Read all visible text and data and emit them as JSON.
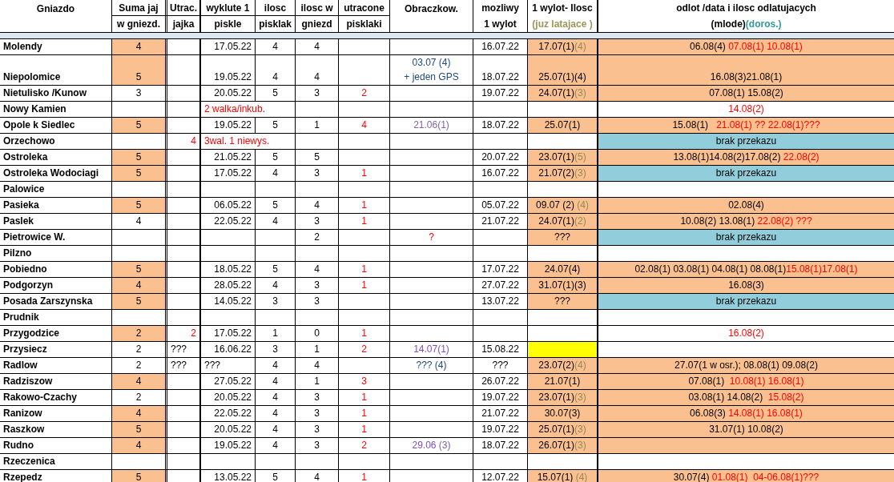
{
  "header": {
    "name": {
      "lines": [
        {
          "text": "Gniazdo"
        }
      ]
    },
    "suma": {
      "lines": [
        {
          "text": "Suma jaj"
        },
        {
          "text": "w gniezd."
        }
      ]
    },
    "utrac": {
      "lines": [
        {
          "text": "Utrac."
        },
        {
          "text": "jajka"
        }
      ]
    },
    "wyklute": {
      "lines": [
        {
          "text": "wyklute 1"
        },
        {
          "text": "piskle"
        }
      ]
    },
    "ilosc": {
      "lines": [
        {
          "text": "ilosc"
        },
        {
          "text": "pisklak"
        }
      ]
    },
    "ilosc_w": {
      "lines": [
        {
          "text": "ilosc w"
        },
        {
          "text": "gniezd"
        }
      ]
    },
    "utracone": {
      "lines": [
        {
          "text": "utracone"
        },
        {
          "text": "pisklaki"
        }
      ]
    },
    "obraczkow": {
      "lines": [
        {
          "text": "Obraczkow."
        }
      ]
    },
    "mozliwy": {
      "lines": [
        {
          "text": "mozliwy"
        },
        {
          "text": "1 wylot"
        }
      ]
    },
    "wylot": {
      "lines": [
        {
          "text": "1 wylot- Ilosc"
        },
        {
          "parts": [
            {
              "text": "(juz latajace )",
              "color": "#9c9658"
            }
          ]
        }
      ]
    },
    "odlot": {
      "lines": [
        {
          "text": "odlot /data i ilosc odlatujacych"
        },
        {
          "parts": [
            {
              "text": "(mlode)",
              "color": "#000000"
            },
            {
              "text": "(doros.)",
              "color": "#2e9c98"
            }
          ]
        }
      ]
    }
  },
  "rows": [
    {
      "name": "Molendy",
      "cells": {
        "suma": {
          "text": "4",
          "color": "#fac090"
        },
        "wyklute": {
          "text": "17.05.22"
        },
        "ilosc": {
          "text": "4"
        },
        "ilosc_w": {
          "text": "4"
        },
        "mozliwy": {
          "text": "16.07.22"
        },
        "wylot": {
          "parts": [
            {
              "text": "17.07(1)",
              "color": "#000000"
            },
            {
              "text": "(4)",
              "color": "#948a54"
            }
          ],
          "color": "#fac090"
        },
        "odlot": {
          "parts": [
            {
              "text": "06.08(4) ",
              "color": "#000000"
            },
            {
              "text": "07.08(1) 10.08(1)",
              "color": "#ff0000"
            }
          ],
          "color": "#fac090"
        }
      }
    },
    {
      "name": "Niepolomice",
      "cells": {
        "suma": {
          "text": "5",
          "color": "#fac090"
        },
        "wyklute": {
          "text": "19.05.22"
        },
        "ilosc": {
          "text": "4"
        },
        "ilosc_w": {
          "text": "4"
        },
        "obraczkow": {
          "parts": [
            {
              "text": "03.07 (4)\n+ jeden GPS",
              "color": "#1f497d"
            }
          ]
        },
        "mozliwy": {
          "text": "18.07.22"
        },
        "wylot": {
          "text": "25.07(1)(4)",
          "color": "#fac090"
        },
        "odlot": {
          "text": "16.08(3)21.08(1)",
          "color": "#fac090"
        }
      }
    },
    {
      "name": "Nietulisko /Kunow",
      "cells": {
        "suma": {
          "text": "3"
        },
        "wyklute": {
          "text": "20.05.22"
        },
        "ilosc": {
          "text": "5"
        },
        "ilosc_w": {
          "text": "3"
        },
        "utracone": {
          "parts": [
            {
              "text": "2",
              "color": "#ff0000"
            }
          ]
        },
        "mozliwy": {
          "text": "19.07.22"
        },
        "wylot": {
          "parts": [
            {
              "text": "24.07(1)",
              "color": "#000000"
            },
            {
              "text": "(3)",
              "color": "#948a54"
            }
          ],
          "color": "#fac090"
        },
        "odlot": {
          "text": "07.08(1) 15.08(2)",
          "color": "#fac090"
        }
      }
    },
    {
      "name": "Nowy Kamien",
      "cells": {
        "wyklute": {
          "parts": [
            {
              "text": "2 walka/inkub.",
              "color": "#ff0000"
            }
          ],
          "kind": "note"
        },
        "odlot": {
          "parts": [
            {
              "text": "14.08(2)",
              "color": "#ff0000"
            }
          ]
        }
      }
    },
    {
      "name": "Opole k Siedlec",
      "cells": {
        "suma": {
          "text": "5",
          "color": "#fac090"
        },
        "wyklute": {
          "text": "19.05.22"
        },
        "ilosc": {
          "text": "5"
        },
        "ilosc_w": {
          "text": "1"
        },
        "utracone": {
          "parts": [
            {
              "text": "4",
              "color": "#ff0000"
            }
          ]
        },
        "obraczkow": {
          "parts": [
            {
              "text": "21.06(1)",
              "color": "#8064a2"
            }
          ]
        },
        "mozliwy": {
          "text": "18.07.22"
        },
        "wylot": {
          "text": "25.07(1)",
          "color": "#fac090"
        },
        "odlot": {
          "parts": [
            {
              "text": "15.08(1)   ",
              "color": "#000000"
            },
            {
              "text": "21.08(1) ?? 22.08(1)???",
              "color": "#ff0000"
            }
          ],
          "color": "#fac090"
        }
      }
    },
    {
      "name": "Orzechowo",
      "cells": {
        "utrac": {
          "parts": [
            {
              "text": "4",
              "color": "#ff0000"
            }
          ]
        },
        "wyklute": {
          "parts": [
            {
              "text": "3wal. 1 niewys.",
              "color": "#ff0000"
            }
          ],
          "kind": "note"
        },
        "odlot": {
          "text": "brak przekazu",
          "color": "#92cddc"
        }
      }
    },
    {
      "name": "Ostroleka",
      "cells": {
        "suma": {
          "text": "5",
          "color": "#fac090"
        },
        "wyklute": {
          "text": "21.05.22"
        },
        "ilosc": {
          "text": "5"
        },
        "ilosc_w": {
          "text": "5"
        },
        "mozliwy": {
          "text": "20.07.22"
        },
        "wylot": {
          "parts": [
            {
              "text": "23.07(1)",
              "color": "#000000"
            },
            {
              "text": "(5)",
              "color": "#948a54"
            }
          ],
          "color": "#fac090"
        },
        "odlot": {
          "parts": [
            {
              "text": "13.08(1)14.08(2)17.08(2) ",
              "color": "#000000"
            },
            {
              "text": "22.08(2)",
              "color": "#ff0000"
            }
          ],
          "color": "#fac090"
        }
      }
    },
    {
      "name": "Ostroleka Wodociagi",
      "cells": {
        "suma": {
          "text": "5",
          "color": "#fac090"
        },
        "wyklute": {
          "text": "17.05.22"
        },
        "ilosc": {
          "text": "4"
        },
        "ilosc_w": {
          "text": "3"
        },
        "utracone": {
          "parts": [
            {
              "text": "1",
              "color": "#ff0000"
            }
          ]
        },
        "mozliwy": {
          "text": "16.07.22"
        },
        "wylot": {
          "parts": [
            {
              "text": "21.07(2)",
              "color": "#000000"
            },
            {
              "text": "(3)",
              "color": "#948a54"
            }
          ],
          "color": "#fac090"
        },
        "odlot": {
          "text": "brak przekazu",
          "color": "#92cddc"
        }
      }
    },
    {
      "name": "Palowice"
    },
    {
      "name": "Pasieka",
      "cells": {
        "suma": {
          "text": "5",
          "color": "#fac090"
        },
        "wyklute": {
          "text": "06.05.22"
        },
        "ilosc": {
          "text": "5"
        },
        "ilosc_w": {
          "text": "4"
        },
        "utracone": {
          "parts": [
            {
              "text": "1",
              "color": "#ff0000"
            }
          ]
        },
        "mozliwy": {
          "text": "05.07.22"
        },
        "wylot": {
          "parts": [
            {
              "text": "09.07 (2) ",
              "color": "#000000"
            },
            {
              "text": "(4)",
              "color": "#948a54"
            }
          ],
          "color": "#fac090"
        },
        "odlot": {
          "text": "02.08(4)",
          "color": "#fac090"
        }
      }
    },
    {
      "name": "Paslek",
      "cells": {
        "suma": {
          "text": "4"
        },
        "wyklute": {
          "text": "22.05.22"
        },
        "ilosc": {
          "text": "4"
        },
        "ilosc_w": {
          "text": "3"
        },
        "utracone": {
          "parts": [
            {
              "text": "1",
              "color": "#ff0000"
            }
          ]
        },
        "mozliwy": {
          "text": "21.07.22"
        },
        "wylot": {
          "parts": [
            {
              "text": "24.07(1)",
              "color": "#000000"
            },
            {
              "text": "(2)",
              "color": "#948a54"
            }
          ],
          "color": "#fac090"
        },
        "odlot": {
          "parts": [
            {
              "text": "10.08(2) 13.08(1) ",
              "color": "#000000"
            },
            {
              "text": "22.08(2) ???",
              "color": "#ff0000"
            }
          ],
          "color": "#fac090"
        }
      }
    },
    {
      "name": "Pietrowice W.",
      "cells": {
        "ilosc_w": {
          "text": "2"
        },
        "obraczkow": {
          "parts": [
            {
              "text": "?",
              "color": "#ff0000"
            }
          ]
        },
        "wylot": {
          "text": "???",
          "color": "#fac090"
        },
        "odlot": {
          "text": "brak przekazu",
          "color": "#92cddc"
        }
      }
    },
    {
      "name": "Pilzno"
    },
    {
      "name": "Pobiedno",
      "cells": {
        "suma": {
          "text": "5",
          "color": "#fac090"
        },
        "wyklute": {
          "text": "18.05.22"
        },
        "ilosc": {
          "text": "5"
        },
        "ilosc_w": {
          "text": "4"
        },
        "utracone": {
          "parts": [
            {
              "text": "1",
              "color": "#ff0000"
            }
          ]
        },
        "mozliwy": {
          "text": "17.07.22"
        },
        "wylot": {
          "text": "24.07(4)",
          "color": "#fac090"
        },
        "odlot": {
          "parts": [
            {
              "text": "02.08(1) 03.08(1) 04.08(1) 08.08(1)",
              "color": "#000000"
            },
            {
              "text": "15.08(1)17.08(1)",
              "color": "#ff0000"
            }
          ],
          "color": "#fac090"
        }
      }
    },
    {
      "name": "Podgorzyn",
      "cells": {
        "suma": {
          "text": "4",
          "color": "#fac090"
        },
        "wyklute": {
          "text": "28.05.22"
        },
        "ilosc": {
          "text": "4"
        },
        "ilosc_w": {
          "text": "3"
        },
        "utracone": {
          "parts": [
            {
              "text": "1",
              "color": "#ff0000"
            }
          ]
        },
        "mozliwy": {
          "text": "27.07.22"
        },
        "wylot": {
          "text": "31.07(1)(3)",
          "color": "#fac090"
        },
        "odlot": {
          "text": "16.08(3)",
          "color": "#fac090"
        }
      }
    },
    {
      "name": "Posada Zarszynska",
      "cells": {
        "suma": {
          "text": "5",
          "color": "#fac090"
        },
        "wyklute": {
          "text": "14.05.22"
        },
        "ilosc": {
          "text": "3"
        },
        "ilosc_w": {
          "text": "3"
        },
        "mozliwy": {
          "text": "13.07.22"
        },
        "wylot": {
          "text": "???",
          "color": "#fac090"
        },
        "odlot": {
          "text": "brak przekazu",
          "color": "#92cddc"
        }
      }
    },
    {
      "name": "Prudnik"
    },
    {
      "name": "Przygodzice",
      "cells": {
        "suma": {
          "text": "2",
          "color": "#fac090"
        },
        "utrac": {
          "parts": [
            {
              "text": "2",
              "color": "#ff0000"
            }
          ]
        },
        "wyklute": {
          "text": "17.05.22"
        },
        "ilosc": {
          "text": "1"
        },
        "ilosc_w": {
          "text": "0"
        },
        "utracone": {
          "parts": [
            {
              "text": "1",
              "color": "#ff0000"
            }
          ]
        },
        "odlot": {
          "parts": [
            {
              "text": "16.08(2)",
              "color": "#ff0000"
            }
          ]
        }
      }
    },
    {
      "name": "Przysiecz",
      "cells": {
        "suma": {
          "text": "2"
        },
        "utrac": {
          "text": "???",
          "kind": "text"
        },
        "wyklute": {
          "text": "16.06.22"
        },
        "ilosc": {
          "text": "3"
        },
        "ilosc_w": {
          "text": "1"
        },
        "utracone": {
          "parts": [
            {
              "text": "2",
              "color": "#ff0000"
            }
          ]
        },
        "obraczkow": {
          "parts": [
            {
              "text": "14.07(1)",
              "color": "#7f4fbf"
            }
          ]
        },
        "mozliwy": {
          "text": "15.08.22"
        },
        "wylot": {
          "color": "#ffff00"
        }
      }
    },
    {
      "name": "Radlow",
      "cells": {
        "suma": {
          "text": "2"
        },
        "utrac": {
          "text": "???",
          "kind": "text"
        },
        "wyklute": {
          "text": "???",
          "kind": "text"
        },
        "ilosc": {
          "text": "4"
        },
        "ilosc_w": {
          "text": "4"
        },
        "obraczkow": {
          "parts": [
            {
              "text": "??? (4)",
              "color": "#1f497d"
            }
          ]
        },
        "mozliwy": {
          "text": "???"
        },
        "wylot": {
          "parts": [
            {
              "text": "23.07(2)",
              "color": "#000000"
            },
            {
              "text": "(4)",
              "color": "#948a54"
            }
          ],
          "color": "#fac090"
        },
        "odlot": {
          "text": "27.07(1 w osr.); 08.08(1) 09.08(2)",
          "color": "#fac090"
        }
      }
    },
    {
      "name": "Radziszow",
      "cells": {
        "suma": {
          "text": "4",
          "color": "#fac090"
        },
        "wyklute": {
          "text": "27.05.22"
        },
        "ilosc": {
          "text": "4"
        },
        "ilosc_w": {
          "text": "1"
        },
        "utracone": {
          "parts": [
            {
              "text": "3",
              "color": "#ff0000"
            }
          ]
        },
        "mozliwy": {
          "text": "26.07.22"
        },
        "wylot": {
          "text": "21.07(1)",
          "color": "#fac090"
        },
        "odlot": {
          "parts": [
            {
              "text": "07.08(1)  ",
              "color": "#000000"
            },
            {
              "text": "10.08(1) 16.08(1)",
              "color": "#ff0000"
            }
          ],
          "color": "#fac090"
        }
      }
    },
    {
      "name": "Rakowo-Czachy",
      "cells": {
        "suma": {
          "text": "2"
        },
        "wyklute": {
          "text": "20.05.22"
        },
        "ilosc": {
          "text": "4"
        },
        "ilosc_w": {
          "text": "3"
        },
        "utracone": {
          "parts": [
            {
              "text": "1",
              "color": "#ff0000"
            }
          ]
        },
        "mozliwy": {
          "text": "19.07.22"
        },
        "wylot": {
          "parts": [
            {
              "text": "23.07(1)",
              "color": "#000000"
            },
            {
              "text": "(3)",
              "color": "#948a54"
            }
          ],
          "color": "#fac090"
        },
        "odlot": {
          "parts": [
            {
              "text": "03.08(1) 14.08(2)  ",
              "color": "#000000"
            },
            {
              "text": "15.08(2)",
              "color": "#ff0000"
            }
          ],
          "color": "#fac090"
        }
      }
    },
    {
      "name": "Ranizow",
      "cells": {
        "suma": {
          "text": "4",
          "color": "#fac090"
        },
        "wyklute": {
          "text": "22.05.22"
        },
        "ilosc": {
          "text": "4"
        },
        "ilosc_w": {
          "text": "3"
        },
        "utracone": {
          "parts": [
            {
              "text": "1",
              "color": "#ff0000"
            }
          ]
        },
        "mozliwy": {
          "text": "21.07.22"
        },
        "wylot": {
          "text": "30.07(3)",
          "color": "#fac090"
        },
        "odlot": {
          "parts": [
            {
              "text": "06.08(3) ",
              "color": "#000000"
            },
            {
              "text": "14.08(1) 16.08(1)",
              "color": "#ff0000"
            }
          ],
          "color": "#fac090"
        }
      }
    },
    {
      "name": "Raszkow",
      "cells": {
        "suma": {
          "text": "5",
          "color": "#fac090"
        },
        "wyklute": {
          "text": "20.05.22"
        },
        "ilosc": {
          "text": "4"
        },
        "ilosc_w": {
          "text": "3"
        },
        "utracone": {
          "parts": [
            {
              "text": "1",
              "color": "#ff0000"
            }
          ]
        },
        "mozliwy": {
          "text": "19.07.22"
        },
        "wylot": {
          "parts": [
            {
              "text": "25.07(1)",
              "color": "#000000"
            },
            {
              "text": "(3)",
              "color": "#948a54"
            }
          ],
          "color": "#fac090"
        },
        "odlot": {
          "text": "31.07(1) 10.08(2)",
          "color": "#fac090"
        }
      }
    },
    {
      "name": "Rudno",
      "cells": {
        "suma": {
          "text": "4",
          "color": "#fac090"
        },
        "wyklute": {
          "text": "19.05.22"
        },
        "ilosc": {
          "text": "4"
        },
        "ilosc_w": {
          "text": "3"
        },
        "utracone": {
          "parts": [
            {
              "text": "2",
              "color": "#ff0000"
            }
          ]
        },
        "obraczkow": {
          "parts": [
            {
              "text": "29.06 ",
              "color": "#7f4fbf"
            },
            {
              "text": "(3)",
              "color": "#8064a2"
            }
          ]
        },
        "mozliwy": {
          "text": "18.07.22"
        },
        "wylot": {
          "parts": [
            {
              "text": "26.07(1)",
              "color": "#000000"
            },
            {
              "text": "(3)",
              "color": "#948a54"
            }
          ],
          "color": "#fac090"
        },
        "odlot": {
          "color": "#fac090"
        }
      }
    },
    {
      "name": "Rzeczenica"
    },
    {
      "name": "Rzepedz",
      "cells": {
        "suma": {
          "text": "5",
          "color": "#fac090"
        },
        "wyklute": {
          "text": "13.05.22"
        },
        "ilosc": {
          "text": "5"
        },
        "ilosc_w": {
          "text": "4"
        },
        "utracone": {
          "parts": [
            {
              "text": "1",
              "color": "#ff0000"
            }
          ]
        },
        "mozliwy": {
          "text": "12.07.22"
        },
        "wylot": {
          "parts": [
            {
              "text": "15.07(1) ",
              "color": "#000000"
            },
            {
              "text": "(4)",
              "color": "#948a54"
            }
          ],
          "color": "#fac090"
        },
        "odlot": {
          "parts": [
            {
              "text": "30.07(4) ",
              "color": "#000000"
            },
            {
              "text": "01.08(1)  04-06.08(1)???",
              "color": "#ff0000"
            }
          ],
          "color": "#fac090"
        }
      }
    }
  ]
}
